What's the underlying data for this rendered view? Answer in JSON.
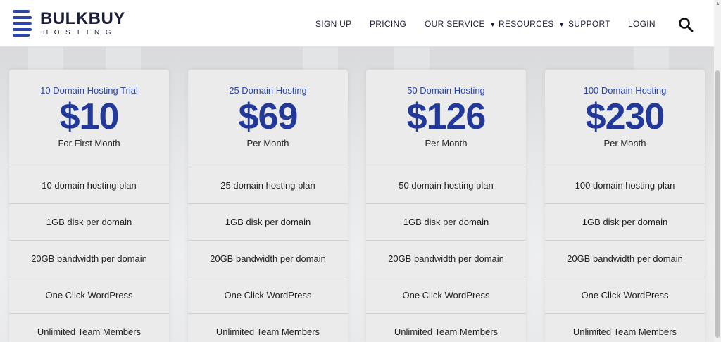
{
  "logo": {
    "word1": "BULK",
    "word2": "BUY",
    "sub": "HOSTING"
  },
  "nav": {
    "items": [
      {
        "label": "SIGN UP"
      },
      {
        "label": "PRICING"
      },
      {
        "label": "OUR SERVICE",
        "caret": "▼"
      },
      {
        "label": "RESOURCES",
        "caret": "▼"
      },
      {
        "label": "SUPPORT"
      },
      {
        "label": "LOGIN"
      }
    ],
    "search_icon": "search-icon"
  },
  "plans": [
    {
      "name": "10 Domain Hosting Trial",
      "price": "$10",
      "period": "For First Month",
      "features": [
        "10 domain hosting plan",
        "1GB disk per domain",
        "20GB bandwidth per domain",
        "One Click WordPress",
        "Unlimited Team Members"
      ]
    },
    {
      "name": "25 Domain Hosting",
      "price": "$69",
      "period": "Per Month",
      "features": [
        "25 domain hosting plan",
        "1GB disk per domain",
        "20GB bandwidth per domain",
        "One Click WordPress",
        "Unlimited Team Members"
      ]
    },
    {
      "name": "50 Domain Hosting",
      "price": "$126",
      "period": "Per Month",
      "features": [
        "50 domain hosting plan",
        "1GB disk per domain",
        "20GB bandwidth per domain",
        "One Click WordPress",
        "Unlimited Team Members"
      ]
    },
    {
      "name": "100 Domain Hosting",
      "price": "$230",
      "period": "Per Month",
      "features": [
        "100 domain hosting plan",
        "1GB disk per domain",
        "20GB bandwidth per domain",
        "One Click WordPress",
        "Unlimited Team Members"
      ]
    }
  ],
  "colors": {
    "brand": "#2a47a8",
    "price": "#22399a",
    "card": "#ebebeb"
  }
}
